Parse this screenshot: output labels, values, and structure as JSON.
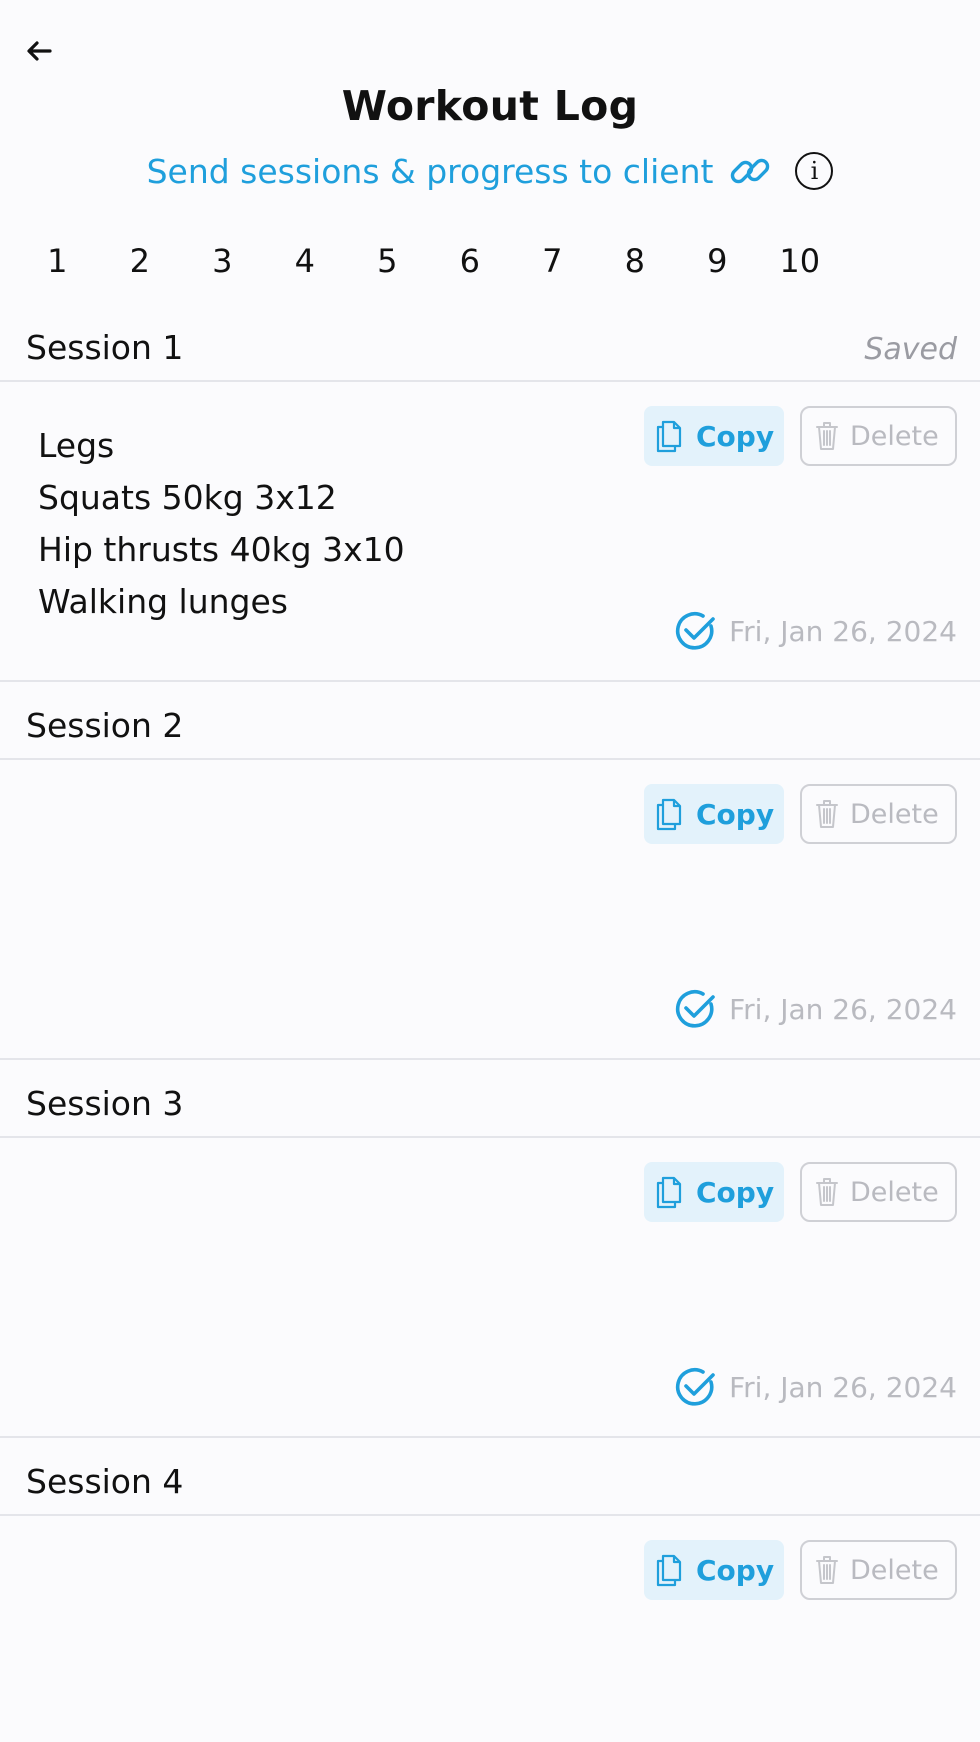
{
  "header": {
    "title": "Workout Log",
    "send_link": "Send sessions & progress to client",
    "info_glyph": "i"
  },
  "pager": {
    "pages": [
      "1",
      "2",
      "3",
      "4",
      "5",
      "6",
      "7",
      "8",
      "9",
      "10"
    ]
  },
  "sessions": [
    {
      "title": "Session 1",
      "status": "Saved",
      "notes": [
        "Legs",
        "Squats 50kg 3x12",
        "Hip thrusts 40kg 3x10",
        "Walking lunges"
      ],
      "copy_label": "Copy",
      "delete_label": "Delete",
      "date": "Fri, Jan 26, 2024"
    },
    {
      "title": "Session 2",
      "status": "",
      "notes": [],
      "copy_label": "Copy",
      "delete_label": "Delete",
      "date": "Fri, Jan 26, 2024"
    },
    {
      "title": "Session 3",
      "status": "",
      "notes": [],
      "copy_label": "Copy",
      "delete_label": "Delete",
      "date": "Fri, Jan 26, 2024"
    },
    {
      "title": "Session 4",
      "status": "",
      "notes": [],
      "copy_label": "Copy",
      "delete_label": "Delete",
      "date": ""
    }
  ],
  "colors": {
    "accent": "#1f9fdc",
    "copy_bg": "#e3f2fb",
    "muted": "#b9bac0",
    "divider": "#e4e5ea"
  },
  "icons": [
    "back-arrow-icon",
    "link-icon",
    "info-icon",
    "copy-icon",
    "trash-icon",
    "check-circle-icon"
  ]
}
